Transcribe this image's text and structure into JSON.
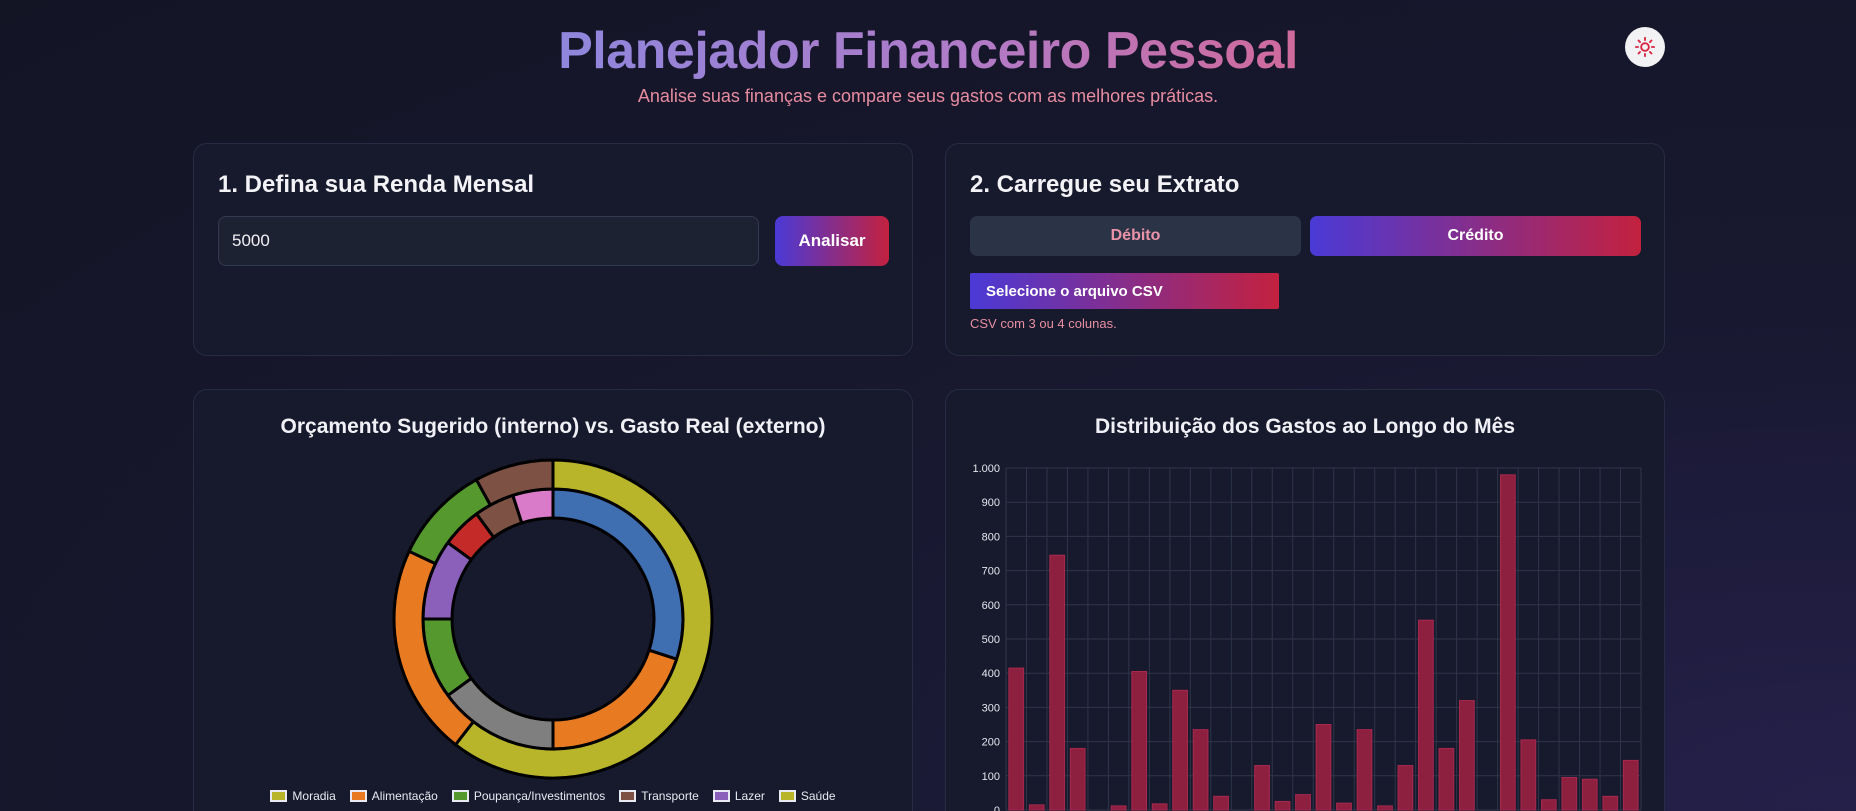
{
  "header": {
    "title": "Planejador Financeiro Pessoal",
    "subtitle": "Analise suas finanças e compare seus gastos com as melhores práticas."
  },
  "theme_toggle": {
    "icon": "sun-icon"
  },
  "income_card": {
    "heading": "1. Defina sua Renda Mensal",
    "income_value": "5000",
    "analyze_label": "Analisar"
  },
  "statement_card": {
    "heading": "2. Carregue seu Extrato",
    "tab_debit": "Débito",
    "tab_credit": "Crédito",
    "selected_tab": "Crédito",
    "file_button_label": "Selecione o arquivo CSV",
    "hint": "CSV com 3 ou 4 colunas."
  },
  "colors": {
    "accent_start": "#4a3ad6",
    "accent_end": "#c3213f",
    "bar": "#8d1f3f"
  },
  "chart_data": [
    {
      "type": "donut",
      "title": "Orçamento Sugerido (interno) vs. Gasto Real (externo)",
      "legend": [
        {
          "label": "Moradia",
          "color": "#b8b52a"
        },
        {
          "label": "Alimentação",
          "color": "#e87a22"
        },
        {
          "label": "Poupança/Investimentos",
          "color": "#55982e"
        },
        {
          "label": "Transporte",
          "color": "#7d5244"
        },
        {
          "label": "Lazer",
          "color": "#8a60bb"
        },
        {
          "label": "Saúde",
          "color": "#b8b52a"
        }
      ],
      "series": [
        {
          "name": "Orçamento Sugerido",
          "slices": [
            {
              "color": "#3f6fb0",
              "value": 30
            },
            {
              "color": "#e87a22",
              "value": 20
            },
            {
              "color": "#7f7f7f",
              "value": 15
            },
            {
              "color": "#55982e",
              "value": 10
            },
            {
              "color": "#8a60bb",
              "value": 10
            },
            {
              "color": "#c42a28",
              "value": 5
            },
            {
              "color": "#7d5244",
              "value": 5
            },
            {
              "color": "#d97bc8",
              "value": 5
            }
          ]
        },
        {
          "name": "Gasto Real",
          "slices": [
            {
              "color": "#b8b52a",
              "value": 60.5
            },
            {
              "color": "#e87a22",
              "value": 21.5
            },
            {
              "color": "#55982e",
              "value": 10
            },
            {
              "color": "#7d5244",
              "value": 8
            }
          ]
        }
      ]
    },
    {
      "type": "bar",
      "title": "Distribuição dos Gastos ao Longo do Mês",
      "ylim": [
        0,
        1000
      ],
      "yticks": [
        "0",
        "100",
        "200",
        "300",
        "400",
        "500",
        "600",
        "700",
        "800",
        "900",
        "1.000"
      ],
      "grid": true,
      "values": [
        415,
        15,
        745,
        180,
        0,
        12,
        405,
        18,
        350,
        235,
        40,
        0,
        130,
        25,
        45,
        250,
        20,
        235,
        12,
        130,
        555,
        180,
        320,
        0,
        980,
        205,
        30,
        95,
        90,
        40,
        145
      ]
    }
  ]
}
